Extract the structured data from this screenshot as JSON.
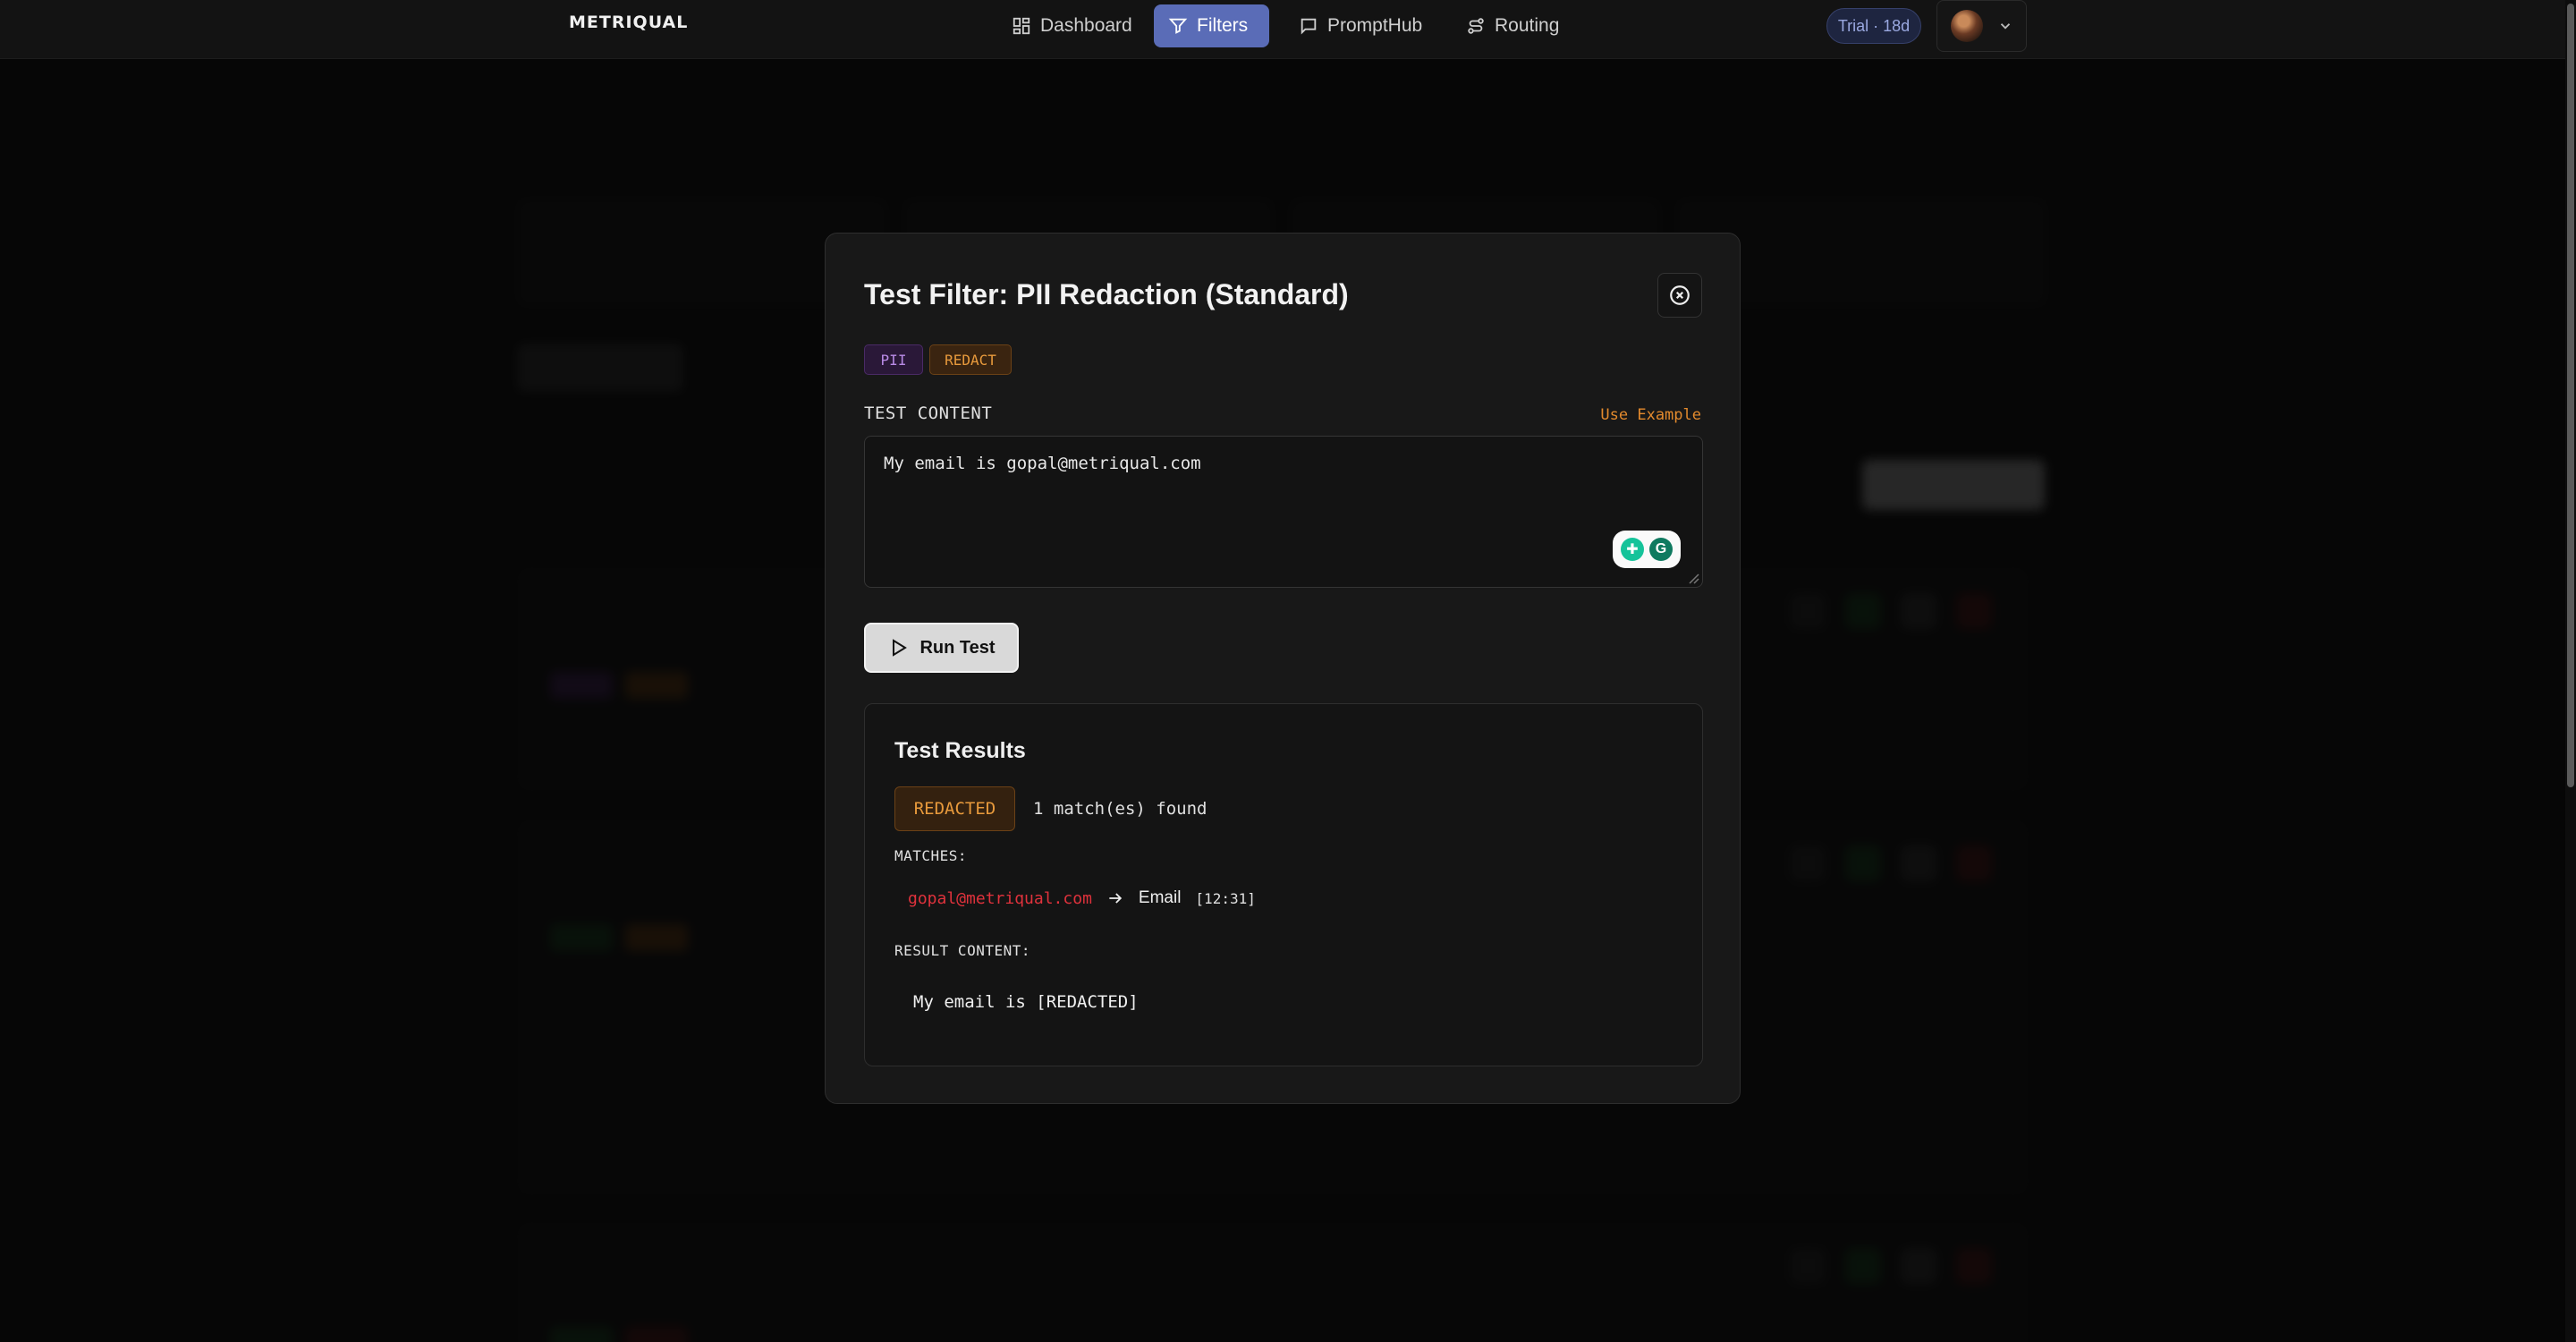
{
  "nav": {
    "logo": "METRIQUAL",
    "tabs": [
      {
        "label": "Dashboard",
        "icon": "dashboard-grid-icon",
        "active": false
      },
      {
        "label": "Filters",
        "icon": "filter-funnel-icon",
        "active": true
      },
      {
        "label": "PromptHub",
        "icon": "chat-bubble-icon",
        "active": false
      },
      {
        "label": "Routing",
        "icon": "routing-icon",
        "active": false
      }
    ],
    "trial_badge": "Trial · 18d",
    "accent_color": "#5a6cb7"
  },
  "modal": {
    "title": "Test Filter: PII Redaction (Standard)",
    "chips": [
      "PII",
      "REDACT"
    ],
    "test_content_label": "TEST CONTENT",
    "use_example_label": "Use Example",
    "test_content_value": "My email is gopal@metriqual.com",
    "run_button_label": "Run Test",
    "results": {
      "title": "Test Results",
      "status": "REDACTED",
      "match_count_text": "1 match(es) found",
      "matches_label": "MATCHES:",
      "matches": [
        {
          "value": "gopal@metriqual.com",
          "type": "Email",
          "position": "[12:31]"
        }
      ],
      "result_content_label": "RESULT CONTENT:",
      "result_content": "My email is [REDACTED]"
    }
  }
}
